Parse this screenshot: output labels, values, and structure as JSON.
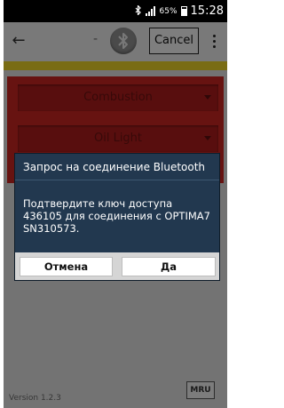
{
  "status_bar": {
    "battery": "65%",
    "time": "15:28",
    "icons": [
      "bluetooth-icon",
      "signal-icon",
      "battery-icon"
    ]
  },
  "app_bar": {
    "title_dash": "-",
    "cancel_label": "Cancel",
    "icons": [
      "back-arrow-icon",
      "bluetooth-icon",
      "overflow-menu-icon"
    ]
  },
  "main": {
    "dropdown1": "Combustion",
    "dropdown2": "Oil Light"
  },
  "dialog": {
    "title": "Запрос на соединение Bluetooth",
    "message": "Подтвердите ключ доступа 436105 для соединения с OPTIMA7 SN310573.",
    "cancel_label": "Отмена",
    "ok_label": "Да"
  },
  "footer": {
    "version": "Version 1.2.3",
    "logo_text": "MRU"
  },
  "colors": {
    "panel_red": "#c62622",
    "accent_yellow": "#e8cf28",
    "dialog_bg": "#22384f"
  }
}
